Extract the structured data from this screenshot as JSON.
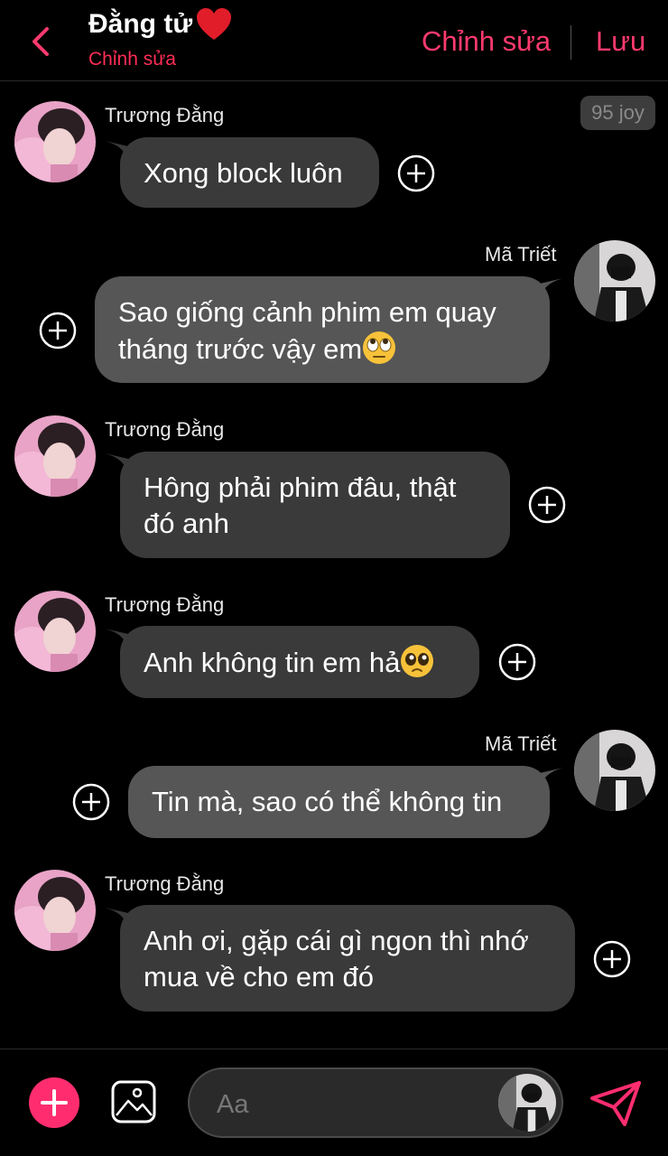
{
  "header": {
    "title": "Đằng tử",
    "subtitle": "Chỉnh sửa",
    "edit_label": "Chỉnh sửa",
    "save_label": "Lưu"
  },
  "badge": "95 joy",
  "messages": [
    {
      "sender": "Trương Đằng",
      "text": "Xong block luôn"
    },
    {
      "sender": "Mã Triết",
      "text_line1": "Sao giống cảnh phim em quay",
      "text_line2": "tháng trước vậy em",
      "emoji": "face-with-rolling-eyes"
    },
    {
      "sender": "Trương Đằng",
      "text_line1": "Hông phải phim đâu, thật",
      "text_line2": "đó anh"
    },
    {
      "sender": "Trương Đằng",
      "text": "Anh không tin em hả",
      "emoji": "pleading-face"
    },
    {
      "sender": "Mã Triết",
      "text": "Tin mà, sao có thể không tin"
    },
    {
      "sender": "Trương Đằng",
      "text_line1": "Anh ơi, gặp cái gì ngon thì nhớ",
      "text_line2": "mua về cho em đó"
    }
  ],
  "composer": {
    "placeholder": "Aa"
  },
  "colors": {
    "accent": "#ff3a6e",
    "bubble": "#3a3a3a",
    "background": "#000000"
  },
  "icons": [
    "back-chevron-icon",
    "heart-icon",
    "plus-circle-icon",
    "image-icon",
    "send-icon",
    "add-icon"
  ]
}
